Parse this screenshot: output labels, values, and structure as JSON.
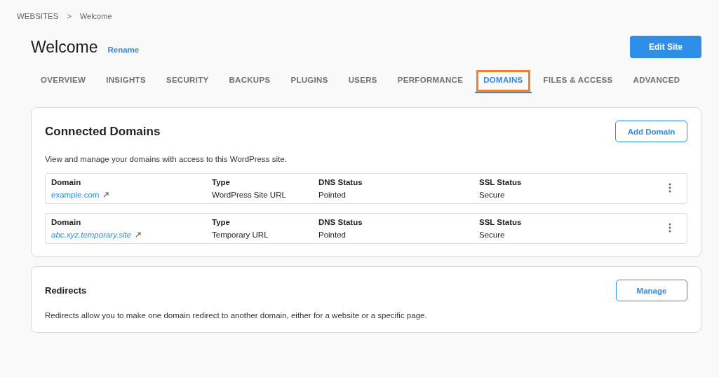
{
  "breadcrumb": {
    "parent": "WEBSITES",
    "separator": ">",
    "current": "Welcome"
  },
  "header": {
    "title": "Welcome",
    "rename": "Rename",
    "edit_button": "Edit Site"
  },
  "tabs": [
    {
      "label": "OVERVIEW",
      "selected": false,
      "highlighted": false
    },
    {
      "label": "INSIGHTS",
      "selected": false,
      "highlighted": false
    },
    {
      "label": "SECURITY",
      "selected": false,
      "highlighted": false
    },
    {
      "label": "BACKUPS",
      "selected": false,
      "highlighted": false
    },
    {
      "label": "PLUGINS",
      "selected": false,
      "highlighted": false
    },
    {
      "label": "USERS",
      "selected": false,
      "highlighted": false
    },
    {
      "label": "PERFORMANCE",
      "selected": false,
      "highlighted": false
    },
    {
      "label": "DOMAINS",
      "selected": true,
      "highlighted": true
    },
    {
      "label": "FILES & ACCESS",
      "selected": false,
      "highlighted": false
    },
    {
      "label": "ADVANCED",
      "selected": false,
      "highlighted": false
    }
  ],
  "connected_domains": {
    "title": "Connected Domains",
    "add_button": "Add Domain",
    "description": "View and manage your domains with access to this WordPress site.",
    "rows": [
      {
        "columns": [
          "Domain",
          "Type",
          "DNS Status",
          "SSL Status"
        ],
        "domain": "example.com",
        "italic": false,
        "type": "WordPress Site URL",
        "dns": "Pointed",
        "ssl": "Secure"
      },
      {
        "columns": [
          "Domain",
          "Type",
          "DNS Status",
          "SSL Status"
        ],
        "domain": "abc.xyz.temporary.site",
        "italic": true,
        "type": "Temporary URL",
        "dns": "Pointed",
        "ssl": "Secure"
      }
    ]
  },
  "redirects": {
    "title": "Redirects",
    "button": "Manage",
    "description": "Redirects allow you to make one domain redirect to another domain, either for a website or a specific page."
  }
}
